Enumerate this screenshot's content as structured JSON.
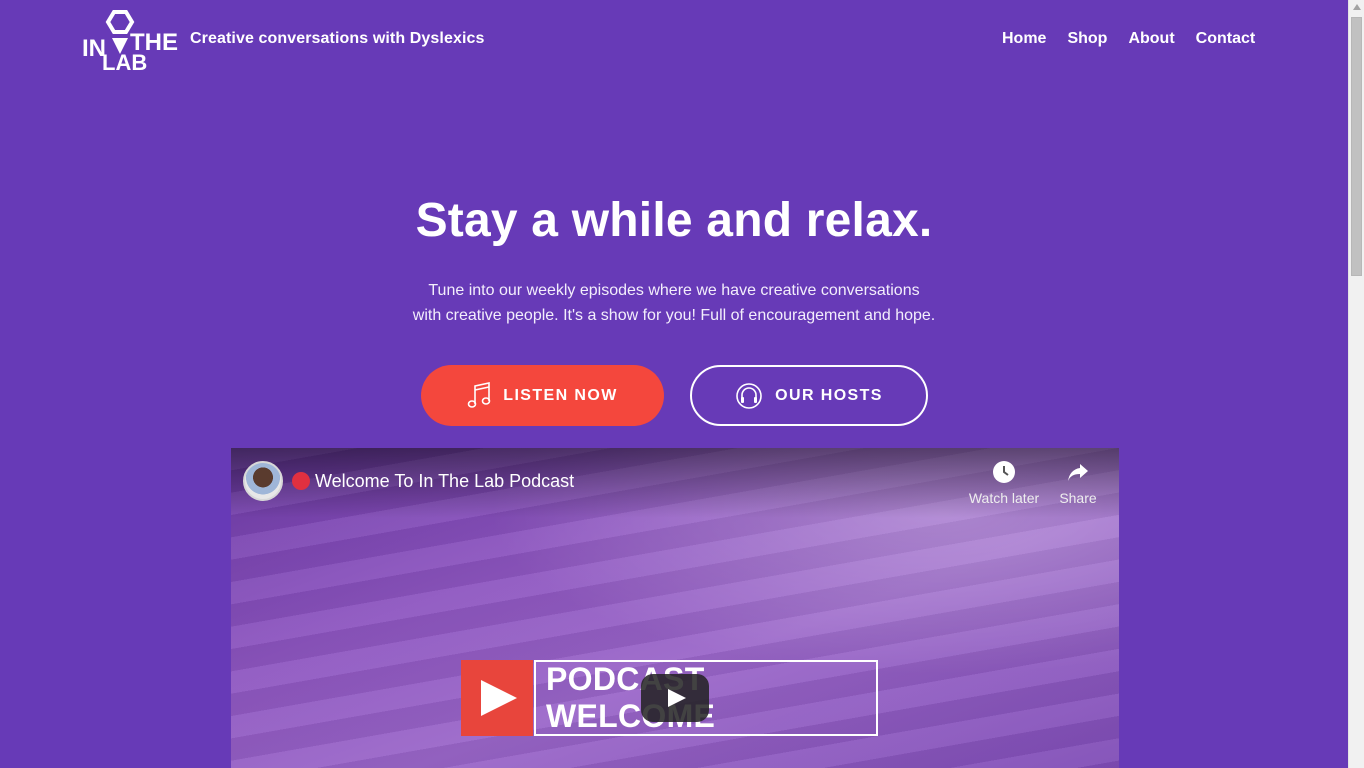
{
  "header": {
    "logo_text": "IN THE LAB",
    "tagline": "Creative conversations with Dyslexics",
    "nav": [
      "Home",
      "Shop",
      "About",
      "Contact"
    ]
  },
  "hero": {
    "title": "Stay a while and relax.",
    "text_line1": "Tune into our weekly episodes where we have creative conversations",
    "text_line2": "with creative people. It's a show for you! Full of encouragement and hope.",
    "buttons": {
      "listen": "LISTEN NOW",
      "hosts": "OUR HOSTS"
    }
  },
  "video": {
    "title": "Welcome To In The Lab Podcast",
    "watch_later": "Watch later",
    "share": "Share",
    "thumbnail_text": "PODCAST WELCOME"
  },
  "colors": {
    "background": "#673ab7",
    "accent": "#f4473d",
    "text": "#ffffff"
  },
  "icons": [
    "music-note-icon",
    "headphones-icon",
    "clock-icon",
    "share-icon",
    "play-icon"
  ]
}
